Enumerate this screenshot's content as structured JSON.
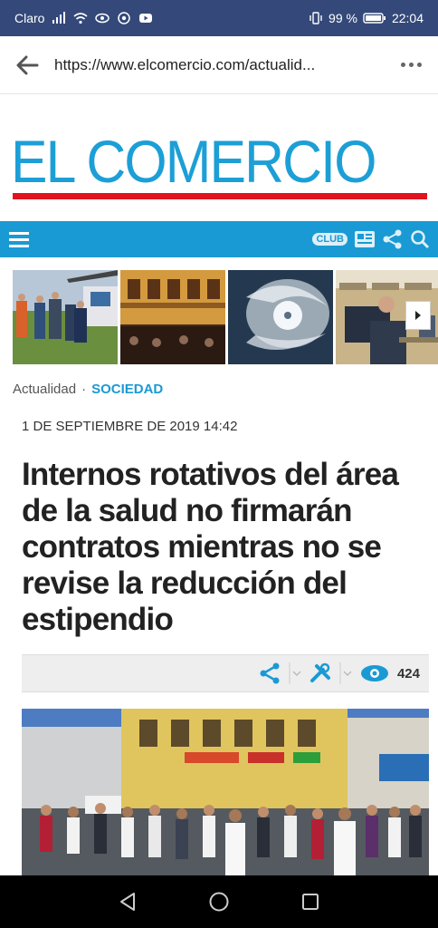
{
  "status_bar": {
    "carrier": "Claro",
    "battery": "99 %",
    "time": "22:04"
  },
  "browser": {
    "url": "https://www.elcomercio.com/actualid..."
  },
  "site": {
    "logo": "EL COMERCIO",
    "club_label": "CLUB"
  },
  "article": {
    "breadcrumb_section": "Actualidad",
    "breadcrumb_separator": "·",
    "breadcrumb_category": "SOCIEDAD",
    "date": "1 DE SEPTIEMBRE DE 2019 14:42",
    "headline": "Internos rotativos del área de la salud no firmarán contratos mientras no se revise la reducción del estipendio",
    "views": "424"
  },
  "colors": {
    "brand_blue": "#1a9ad5",
    "brand_red": "#e2131f",
    "status_bar": "#34497a"
  },
  "icons": {
    "back": "back-arrow-icon",
    "more": "more-icon",
    "menu": "hamburger-icon",
    "share": "share-icon",
    "tools": "tools-icon",
    "views": "eye-icon"
  }
}
